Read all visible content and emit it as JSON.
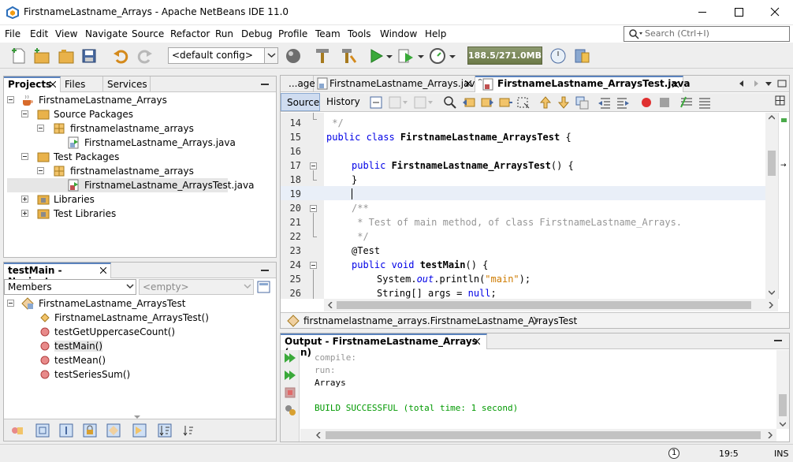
{
  "window": {
    "title": "FirstnameLastname_Arrays - Apache NetBeans IDE 11.0"
  },
  "menu": [
    "File",
    "Edit",
    "View",
    "Navigate",
    "Source",
    "Refactor",
    "Run",
    "Debug",
    "Profile",
    "Team",
    "Tools",
    "Window",
    "Help"
  ],
  "search": {
    "placeholder": "Search (Ctrl+I)"
  },
  "toolbar": {
    "config": "<default config>",
    "memory": "188.5/271.0MB"
  },
  "projects_panel": {
    "tabs": [
      "Projects",
      "Files",
      "Services"
    ],
    "tree": [
      "FirstnameLastname_Arrays",
      "Source Packages",
      "firstnamelastname_arrays",
      "FirstnameLastname_Arrays.java",
      "Test Packages",
      "firstnamelastname_arrays",
      "FirstnameLastname_ArraysTest.java",
      "Libraries",
      "Test Libraries"
    ]
  },
  "navigator": {
    "title": "testMain - Navigator",
    "filter": "Members",
    "empty": "<empty>",
    "class_name": "FirstnameLastname_ArraysTest",
    "members": [
      "FirstnameLastname_ArraysTest()",
      "testGetUppercaseCount()",
      "testMain()",
      "testMean()",
      "testSeriesSum()"
    ]
  },
  "editor": {
    "tabs": [
      "...age",
      "FirstnameLastname_Arrays.java",
      "FirstnameLastname_ArraysTest.java"
    ],
    "source_label": "Source",
    "history_label": "History",
    "line_numbers": [
      "14",
      "15",
      "16",
      "17",
      "18",
      "19",
      "20",
      "21",
      "22",
      "23",
      "24",
      "25",
      "26"
    ],
    "lines": {
      "l14": " */",
      "l15_kw": "public class ",
      "l15_name": "FirstnameLastname_ArraysTest",
      "l15_rest": " {",
      "l17_kw": "public ",
      "l17_name": "FirstnameLastname_ArraysTest",
      "l17_rest": "() {",
      "l18": "}",
      "l20": "/**",
      "l21": " * Test of main method, of class FirstnameLastname_Arrays.",
      "l22": " */",
      "l23": "@Test",
      "l24_kw": "public void ",
      "l24_name": "testMain",
      "l24_rest": "() {",
      "l25_a": "System.",
      "l25_out": "out",
      "l25_b": ".println(",
      "l25_str": "\"main\"",
      "l25_c": ");",
      "l26_a": "String[] args = ",
      "l26_kw": "null",
      "l26_c": ";"
    },
    "breadcrumb": "firstnamelastname_arrays.FirstnameLastname_ArraysTest"
  },
  "output": {
    "title": "Output - FirstnameLastname_Arrays (run)",
    "lines": [
      "compile:",
      "run:",
      "Arrays",
      "",
      "BUILD SUCCESSFUL (total time: 1 second)"
    ]
  },
  "status": {
    "notifications": "1",
    "position": "19:5",
    "mode": "INS"
  },
  "colors": {
    "accent": "#5a82bd",
    "success": "#009900",
    "keyword": "#0000e6",
    "comment": "#969696",
    "string": "#ce7b00"
  }
}
